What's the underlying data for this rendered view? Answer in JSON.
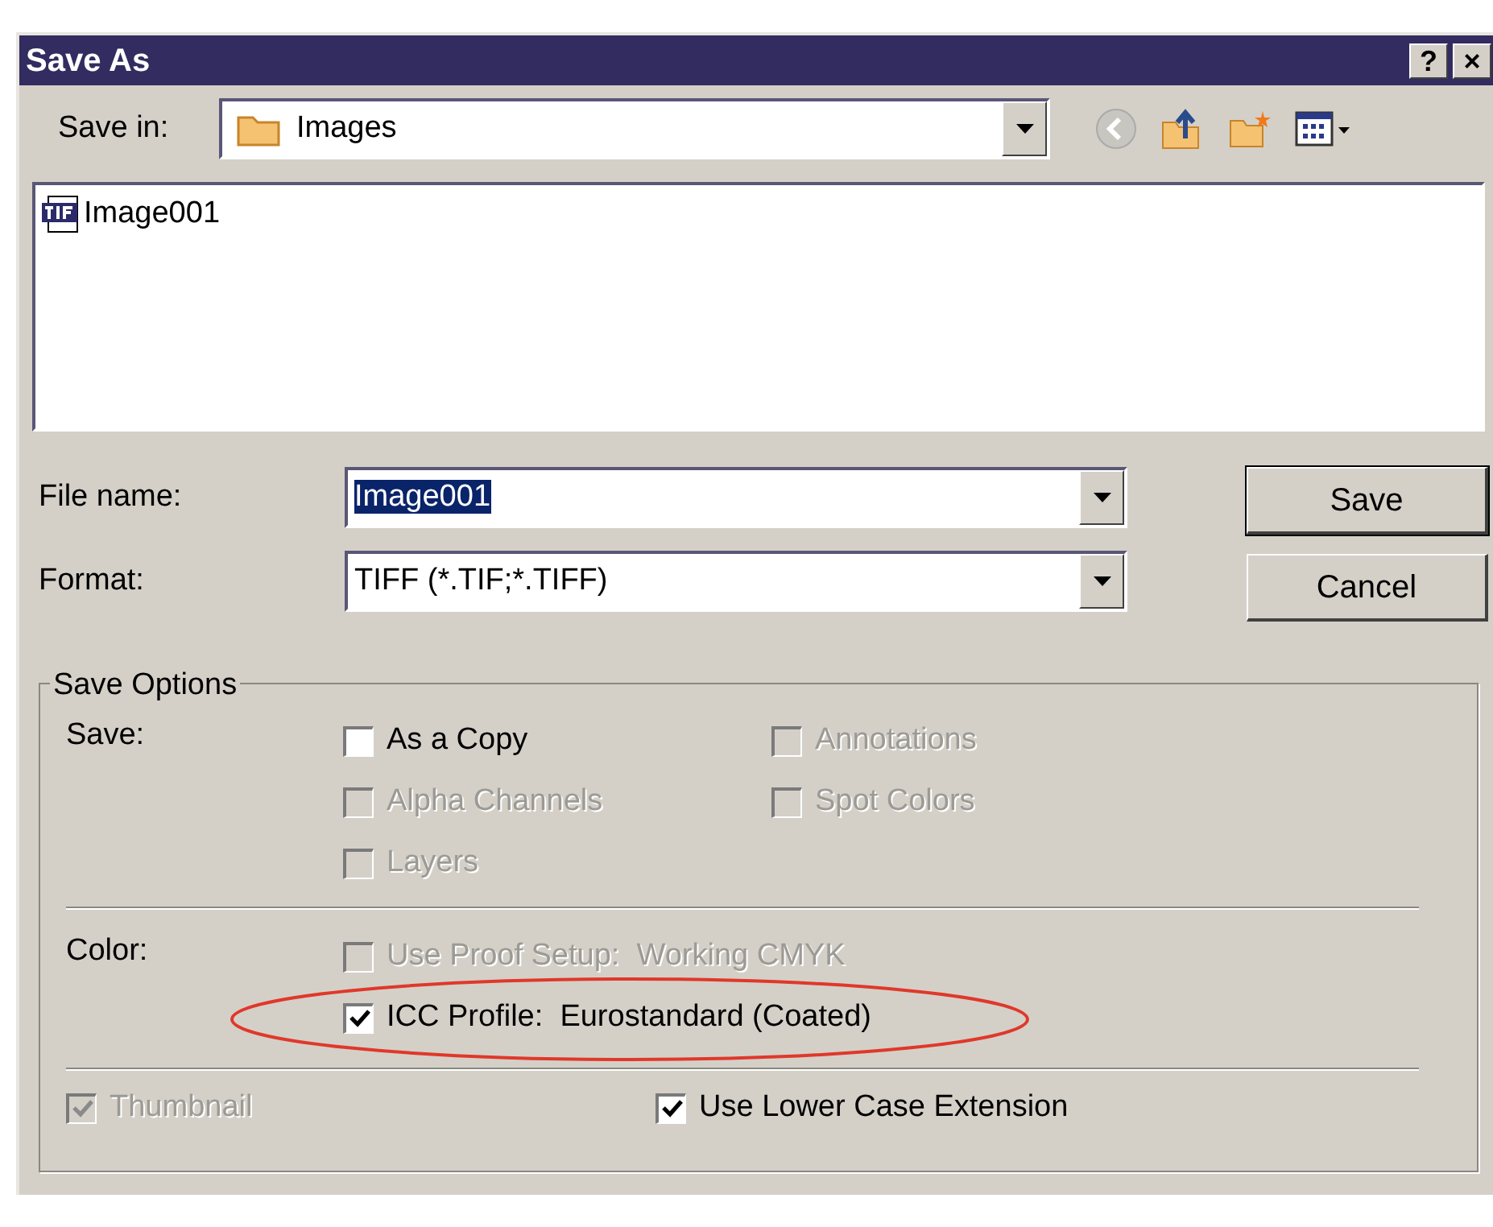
{
  "window": {
    "title": "Save As",
    "title_buttons": [
      "?",
      "×"
    ]
  },
  "save_in": {
    "label": "Save in:",
    "value": "Images"
  },
  "files": [
    {
      "name": "Image001",
      "selected": false
    }
  ],
  "file_name": {
    "label": "File name:",
    "value": "Image001",
    "text_selected": true
  },
  "format": {
    "label": "Format:",
    "value": "TIFF (*.TIF;*.TIFF)"
  },
  "buttons": [
    {
      "label": "Save",
      "default": true
    },
    {
      "label": "Cancel",
      "default": false
    }
  ],
  "save_options": {
    "title": "Save Options",
    "save_label": "Save:",
    "save_items": [
      {
        "label": "As a Copy",
        "checked": false,
        "disabled": false
      },
      {
        "label": "Annotations",
        "checked": false,
        "disabled": true
      },
      {
        "label": "Alpha Channels",
        "checked": false,
        "disabled": true
      },
      {
        "label": "Spot Colors",
        "checked": false,
        "disabled": true
      },
      {
        "label": "Layers",
        "checked": false,
        "disabled": true
      }
    ],
    "color_label": "Color:",
    "color_items": [
      {
        "label": "Use Proof Setup:  Working CMYK",
        "checked": false,
        "disabled": true,
        "highlighted": false
      },
      {
        "label": "ICC Profile:  Eurostandard (Coated)",
        "checked": true,
        "disabled": false,
        "highlighted": true
      }
    ],
    "bottom_items": [
      {
        "label": "Thumbnail",
        "checked": true,
        "disabled": true
      },
      {
        "label": "Use Lower Case Extension",
        "checked": true,
        "disabled": false
      }
    ]
  }
}
